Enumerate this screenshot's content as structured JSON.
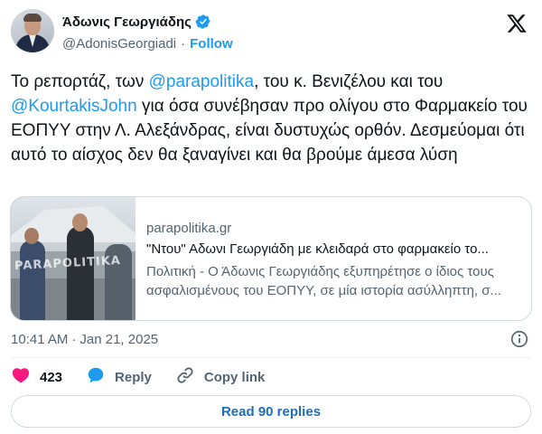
{
  "author": {
    "name": "Άδωνις Γεωργιάδης",
    "handle": "@AdonisGeorgiadi",
    "separator": "·",
    "follow_label": "Follow",
    "verified": true
  },
  "tweet": {
    "segments": [
      {
        "text": "Το ρεπορτάζ, των ",
        "type": "text"
      },
      {
        "text": "@parapolitika",
        "type": "mention"
      },
      {
        "text": ", του κ. Βενιζέλου και του ",
        "type": "text"
      },
      {
        "text": "@KourtakisJohn",
        "type": "mention"
      },
      {
        "text": " για όσα συνέβησαν προ ολίγου στο Φαρμακείο του ΕΟΠΥΥ στην Λ. Αλεξάνδρας, είναι δυστυχώς ορθόν. Δεσμεύομαι ότι αυτό το αίσχος δεν θα ξαναγίνει και θα βρούμε άμεσα λύση",
        "type": "text"
      }
    ]
  },
  "link_card": {
    "domain": "parapolitika.gr",
    "title": "\"Ντου\" Αδωνι Γεωργιάδη με κλειδαρά στο φαρμακείο το...",
    "description": "Πολιτική - Ο Άδωνις Γεωργιάδης εξυπηρέτησε ο ίδιος τους ασφαλισμένους του ΕΟΠΥΥ, σε μία ιστορία ασύλληπτη, σ...",
    "thumbnail_watermark": "PARAPOLITIKA"
  },
  "meta": {
    "time": "10:41 AM",
    "separator": "·",
    "date": "Jan 21, 2025"
  },
  "actions": {
    "like_count": "423",
    "reply_label": "Reply",
    "copy_link_label": "Copy link"
  },
  "read_replies_label": "Read 90 replies",
  "colors": {
    "accent": "#1d9bf0",
    "like": "#f91880",
    "muted": "#536471",
    "border": "#cfd9de"
  },
  "icons": {
    "verified": "verified-badge-icon",
    "logo": "x-logo-icon",
    "info": "info-icon",
    "like": "heart-icon",
    "reply": "speech-bubble-icon",
    "copy_link": "link-icon"
  }
}
